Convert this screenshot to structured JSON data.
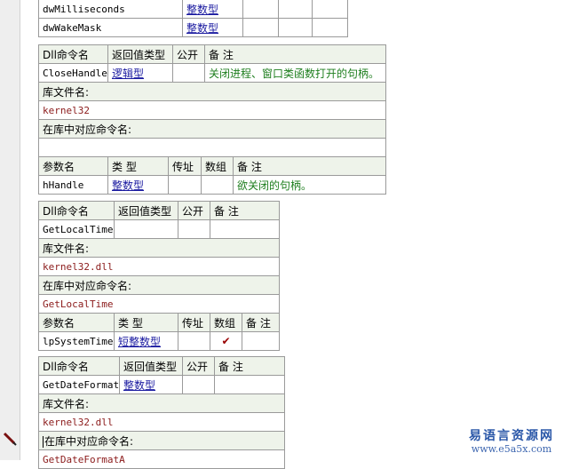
{
  "top_params": [
    {
      "name": "dwMilliseconds",
      "type": "整数型"
    },
    {
      "name": "dwWakeMask",
      "type": "整数型"
    }
  ],
  "headers": {
    "dll_name": "Dll命令名",
    "return_type": "返回值类型",
    "public": "公开",
    "note": "备 注",
    "lib_file": "库文件名:",
    "lib_command": "在库中对应命令名:",
    "param_name": "参数名",
    "type": "类 型",
    "by_ref": "传址",
    "array": "数组"
  },
  "close_handle": {
    "name": "CloseHandle",
    "return_type": "逻辑型",
    "note": "关闭进程、窗口类函数打开的句柄。",
    "lib": "kernel32",
    "lib_command": "",
    "param": {
      "name": "hHandle",
      "type": "整数型",
      "note": "欲关闭的句柄。"
    }
  },
  "get_local_time": {
    "name": "GetLocalTime",
    "return_type": "",
    "lib": "kernel32.dll",
    "lib_command": "GetLocalTime",
    "param": {
      "name": "lpSystemTime",
      "type": "短整数型",
      "array_checked": "✔"
    }
  },
  "get_date_format": {
    "name": "GetDateFormat",
    "return_type": "整数型",
    "lib": "kernel32.dll",
    "lib_command": "GetDateFormatA"
  },
  "watermark": {
    "title": "易语言资源网",
    "url": "www.e5a5x.com"
  }
}
